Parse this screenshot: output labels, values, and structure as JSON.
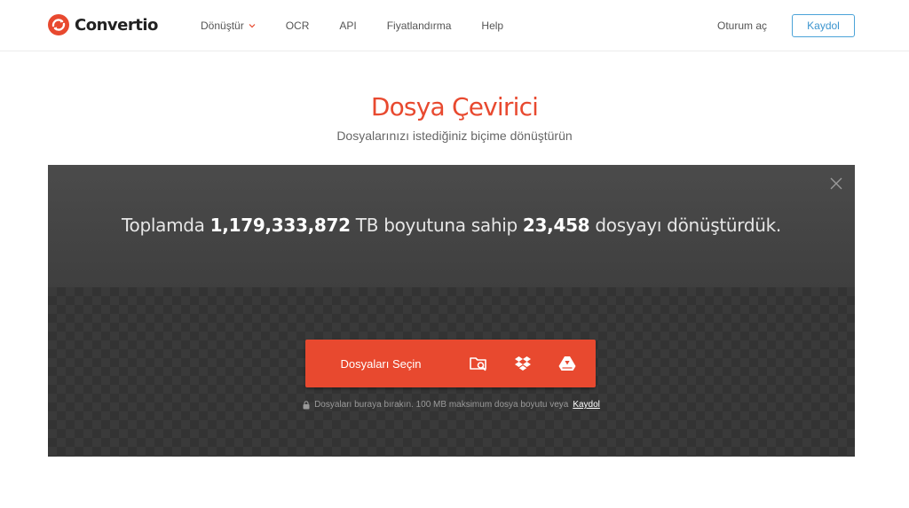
{
  "brand": {
    "name": "Convertio",
    "color": "#e8492f"
  },
  "nav": {
    "items": [
      {
        "label": "Dönüştür",
        "has_dropdown": true
      },
      {
        "label": "OCR"
      },
      {
        "label": "API"
      },
      {
        "label": "Fiyatlandırma"
      },
      {
        "label": "Help"
      }
    ],
    "signin": "Oturum aç",
    "signup": "Kaydol"
  },
  "hero": {
    "title": "Dosya Çevirici",
    "subtitle": "Dosyalarınızı istediğiniz biçime dönüştürün"
  },
  "stats": {
    "prefix": "Toplamda",
    "total_size": "1,179,333,872",
    "size_unit_text": "TB boyutuna sahip",
    "file_count": "23,458",
    "suffix": "dosyayı dönüştürdük."
  },
  "converter": {
    "choose_label": "Dosyaları Seçin",
    "sources": [
      "folder-search-icon",
      "dropbox-icon",
      "google-drive-icon"
    ],
    "hint_text": "Dosyaları buraya bırakın. 100 MB maksimum dosya boyutu veya",
    "hint_link": "Kaydol"
  },
  "colors": {
    "accent": "#e8492f",
    "link": "#3c95cf",
    "panel": "#3f3f3f"
  }
}
